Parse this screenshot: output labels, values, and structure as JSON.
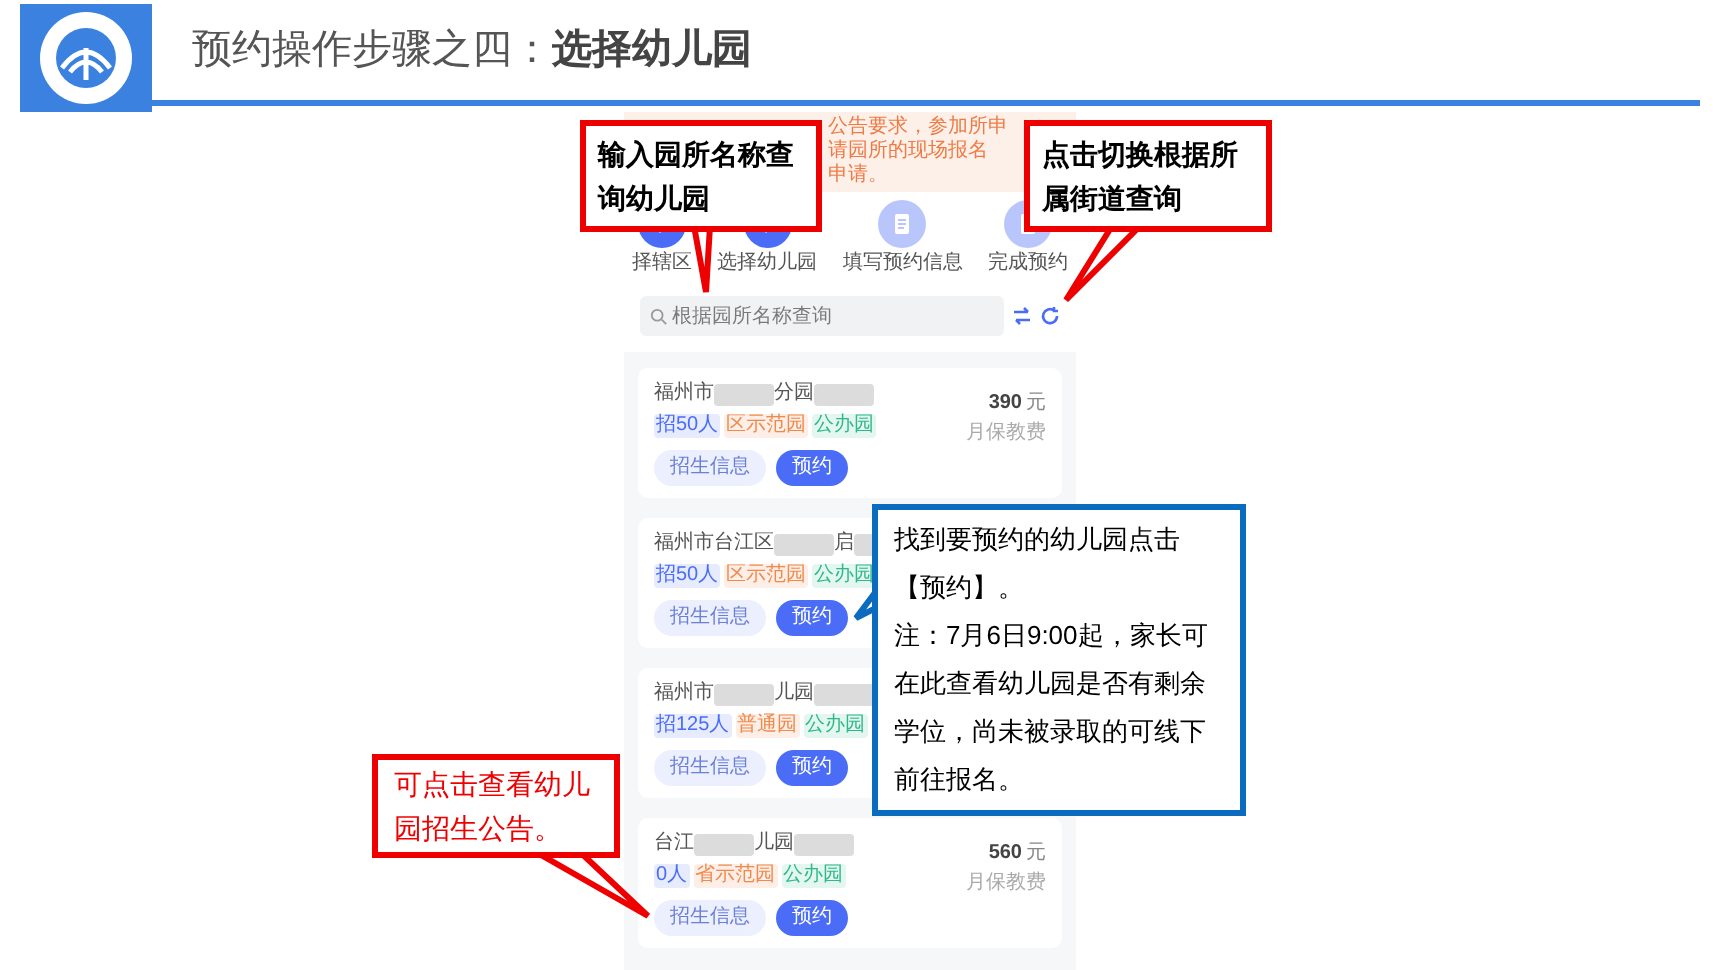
{
  "header": {
    "title_prefix": "预约操作步骤之四：",
    "title_main": "选择幼儿园"
  },
  "phone": {
    "notice": [
      "公告要求，参加所申请园所的现场报名",
      "申请。"
    ],
    "steps": [
      {
        "kind": "done",
        "label": "择辖区"
      },
      {
        "kind": "done",
        "label": "选择幼儿园"
      },
      {
        "kind": "pending",
        "label": "填写预约信息"
      },
      {
        "kind": "pending",
        "label": "完成预约"
      }
    ],
    "search": {
      "placeholder": "根据园所名称查询"
    },
    "cards": [
      {
        "name": [
          {
            "kind": "text",
            "text": "福州市"
          },
          {
            "kind": "blur"
          },
          {
            "kind": "text",
            "text": "分园"
          },
          {
            "kind": "blur"
          }
        ],
        "tags": [
          {
            "label": "招50人",
            "color": "#4a6cf7"
          },
          {
            "label": "区示范园",
            "color": "#f08a4b"
          },
          {
            "label": "公办园",
            "color": "#2fb98a"
          }
        ],
        "price": "390",
        "unit": "元",
        "fee": "月保教费",
        "buttons": [
          "招生信息",
          "预约"
        ]
      },
      {
        "name": [
          {
            "kind": "text",
            "text": "福州市台江区"
          },
          {
            "kind": "blur"
          },
          {
            "kind": "text",
            "text": "启"
          },
          {
            "kind": "blur"
          }
        ],
        "tags": [
          {
            "label": "招50人",
            "color": "#4a6cf7"
          },
          {
            "label": "区示范园",
            "color": "#f08a4b"
          },
          {
            "label": "公办园",
            "color": "#2fb98a"
          }
        ],
        "buttons": [
          "招生信息",
          "预约"
        ]
      },
      {
        "name": [
          {
            "kind": "text",
            "text": "福州市"
          },
          {
            "kind": "blur"
          },
          {
            "kind": "text",
            "text": "儿园"
          },
          {
            "kind": "blur"
          }
        ],
        "tags": [
          {
            "label": "招125人",
            "color": "#4a6cf7"
          },
          {
            "label": "普通园",
            "color": "#f08a4b"
          },
          {
            "label": "公办园",
            "color": "#2fb98a"
          }
        ],
        "buttons": [
          "招生信息",
          "预约"
        ]
      },
      {
        "name": [
          {
            "kind": "text",
            "text": "台江"
          },
          {
            "kind": "blur"
          },
          {
            "kind": "text",
            "text": "儿园"
          },
          {
            "kind": "blur"
          }
        ],
        "tags": [
          {
            "label": "0人",
            "color": "#4a6cf7"
          },
          {
            "label": "省示范园",
            "color": "#f08a4b"
          },
          {
            "label": "公办园",
            "color": "#2fb98a"
          }
        ],
        "price": "560",
        "unit": "元",
        "fee": "月保教费",
        "buttons": [
          "招生信息",
          "预约"
        ]
      }
    ]
  },
  "callouts": [
    {
      "kind": "red",
      "text": "输入园所名称查询幼儿园"
    },
    {
      "kind": "red",
      "text": "点击切换根据所属街道查询"
    },
    {
      "kind": "blue",
      "lines": [
        "找到要预约的幼儿园点击【预约】。",
        "注：7月6日9:00起，家长可在此查看幼儿园是否有剩余学位，尚未被录取的可线下前往报名。"
      ]
    },
    {
      "kind": "redtext",
      "text": "可点击查看幼儿园招生公告。"
    }
  ]
}
